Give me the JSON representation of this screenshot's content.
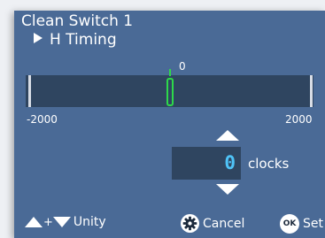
{
  "header": {
    "title": "Clean Switch 1",
    "subtitle": "H Timing"
  },
  "slider": {
    "min_label": "-2000",
    "max_label": "2000",
    "center_label": "0",
    "value": 0,
    "min": -2000,
    "max": 2000
  },
  "value_input": {
    "value": "0",
    "unit": "clocks"
  },
  "footer": {
    "plus": "+",
    "unity_label": "Unity",
    "cancel_label": "Cancel",
    "ok_icon_text": "OK",
    "set_label": "Set"
  },
  "colors": {
    "panel": "#4a6a96",
    "track": "#2f4560",
    "marker": "#2ed84a",
    "value_text": "#4fc3f7",
    "text": "#ffffff"
  },
  "icons": {
    "subtitle": "triangle-right-icon",
    "increase": "triangle-up-icon",
    "decrease": "triangle-down-icon",
    "cancel": "gear-icon",
    "set": "ok-icon"
  }
}
